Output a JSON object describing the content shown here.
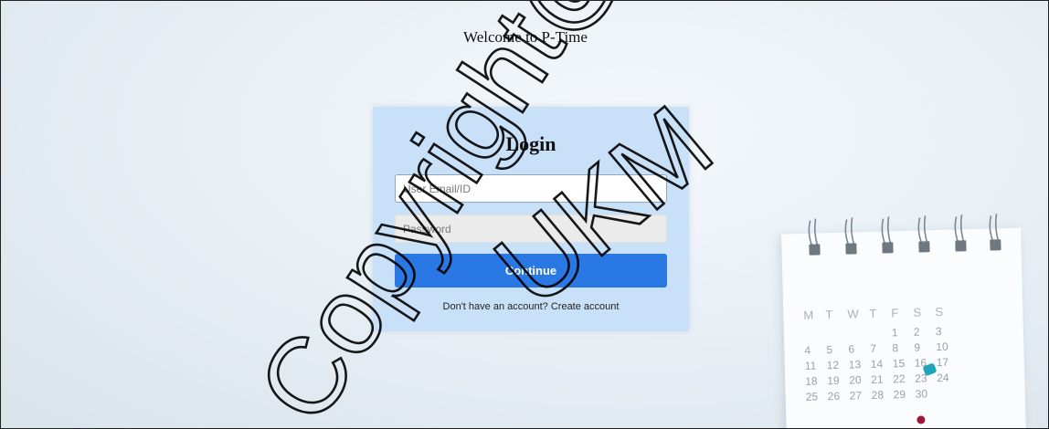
{
  "page": {
    "welcome_text": "Welcome to P-Time"
  },
  "login": {
    "title": "Login",
    "email_placeholder": "User Email/ID",
    "password_placeholder": "Password",
    "continue_label": "Continue",
    "signup_prompt": "Don't have an account?",
    "signup_link": "Create account"
  },
  "calendar": {
    "weekdays": [
      "M",
      "T",
      "W",
      "T",
      "F",
      "S",
      "S"
    ],
    "days": [
      "",
      "",
      "",
      "",
      "1",
      "2",
      "3",
      "4",
      "5",
      "6",
      "7",
      "8",
      "9",
      "10",
      "11",
      "12",
      "13",
      "14",
      "15",
      "16",
      "17",
      "18",
      "19",
      "20",
      "21",
      "22",
      "23",
      "24",
      "25",
      "26",
      "27",
      "28",
      "29",
      "30"
    ]
  },
  "watermark": {
    "line1": "Copyright@",
    "line2": "UKM"
  },
  "colors": {
    "panel_bg": "#c9e1f8",
    "button_bg": "#2a78e4",
    "watermark": "#000000"
  }
}
